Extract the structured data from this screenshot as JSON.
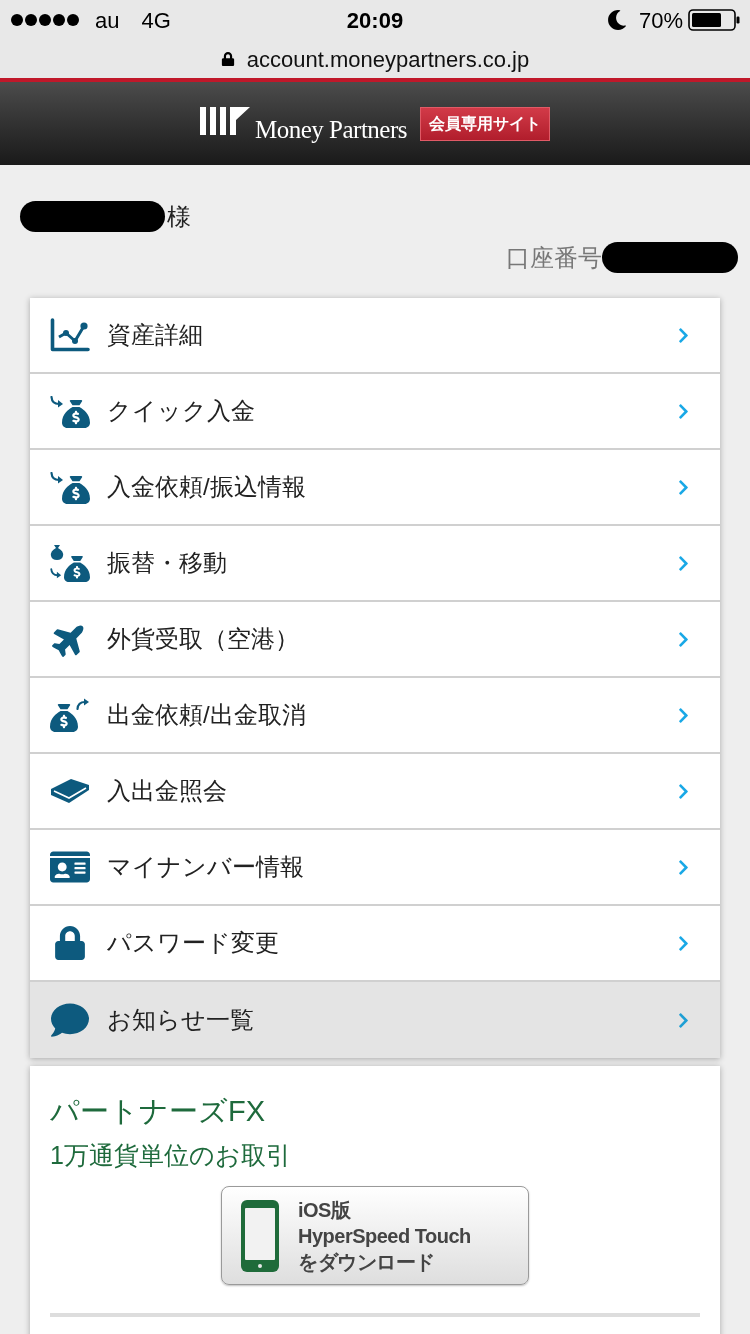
{
  "status_bar": {
    "carrier": "au",
    "network": "4G",
    "time": "20:09",
    "battery": "70%"
  },
  "address_bar": {
    "url": "account.moneypartners.co.jp"
  },
  "header": {
    "logo_text": "Money Partners",
    "badge": "会員専用サイト"
  },
  "greeting": {
    "redacted": true,
    "suffix": "様"
  },
  "account": {
    "label": "口座番号",
    "redacted": true
  },
  "menu": [
    {
      "label": "資産詳細",
      "selected": false
    },
    {
      "label": "クイック入金",
      "selected": false
    },
    {
      "label": "入金依頼/振込情報",
      "selected": false
    },
    {
      "label": "振替・移動",
      "selected": false
    },
    {
      "label": "外貨受取（空港）",
      "selected": false
    },
    {
      "label": "出金依頼/出金取消",
      "selected": false
    },
    {
      "label": "入出金照会",
      "selected": false
    },
    {
      "label": "マイナンバー情報",
      "selected": false
    },
    {
      "label": "パスワード変更",
      "selected": false
    },
    {
      "label": "お知らせ一覧",
      "selected": true
    }
  ],
  "promo": {
    "title": "パートナーズFX",
    "subtitle": "1万通貨単位のお取引",
    "download_button": {
      "lines": [
        "iOS版",
        "HyperSpeed Touch",
        "をダウンロード"
      ]
    }
  }
}
